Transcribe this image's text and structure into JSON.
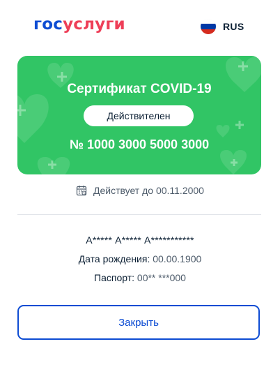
{
  "header": {
    "logo_part1": "гос",
    "logo_part2": "услуги",
    "language": "RUS",
    "flag_colors": [
      "#ffffff",
      "#0039a6",
      "#d52b1e"
    ]
  },
  "certificate": {
    "title": "Сертификат COVID-19",
    "status": "Действителен",
    "number": "№ 1000 3000 5000 3000",
    "card_color": "#31c565"
  },
  "validity": {
    "icon": "calendar-icon",
    "text": "Действует до 00.11.2000"
  },
  "person": {
    "name": "А***** А***** А***********",
    "dob_label": "Дата рождения:",
    "dob_value": "00.00.1900",
    "passport_label": "Паспорт:",
    "passport_value": "00** ***000"
  },
  "actions": {
    "close_label": "Закрыть"
  },
  "colors": {
    "brand_blue": "#0d4cd3",
    "brand_red": "#ee3f58",
    "text_primary": "#0b1f33",
    "text_secondary": "#4d5b6a"
  }
}
